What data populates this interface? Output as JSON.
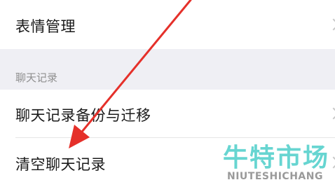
{
  "settings": {
    "items": [
      {
        "label": "表情管理"
      },
      {
        "label": "聊天记录备份与迁移"
      },
      {
        "label": "清空聊天记录"
      }
    ],
    "section_header": "聊天记录"
  },
  "colors": {
    "arrow": "#e5302a",
    "section_bg": "#efeff4",
    "watermark_logo": "#5fd3cf"
  },
  "watermark": {
    "logo": "牛特市场",
    "subtitle": "NIUTESHICHANG"
  }
}
